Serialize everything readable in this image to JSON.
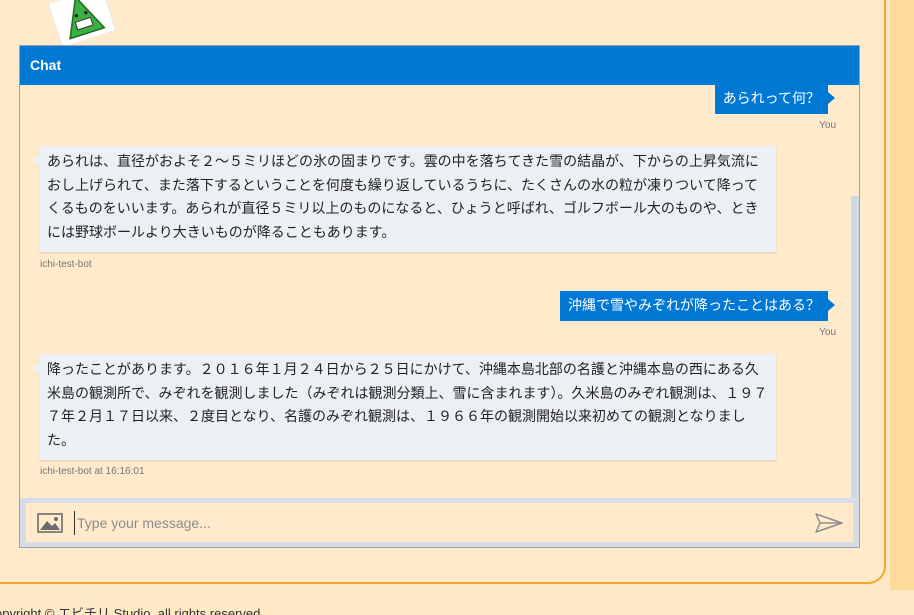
{
  "chat": {
    "title": "Chat",
    "messages": [
      {
        "from": "user",
        "text": "あられって何？",
        "meta": "You"
      },
      {
        "from": "bot",
        "text": "あられは、直径がおよそ２～５ミリほどの氷の固まりです。雲の中を落ちてきた雪の結晶が、下からの上昇気流におし上げられて、また落下するということを何度も繰り返しているうちに、たくさんの水の粒が凍りついて降ってくるものをいいます。あられが直径５ミリ以上のものになると、ひょうと呼ばれ、ゴルフボール大のものや、ときには野球ボールより大きいものが降ることもあります。",
        "meta": "ichi-test-bot"
      },
      {
        "from": "user",
        "text": "沖縄で雪やみぞれが降ったことはある？",
        "meta": "You"
      },
      {
        "from": "bot",
        "text": "降ったことがあります。２０１６年１月２４日から２５日にかけて、沖縄本島北部の名護と沖縄本島の西にある久米島の観測所で、みぞれを観測しました（みぞれは観測分類上、雪に含まれます）。久米島のみぞれ観測は、１９７７年２月１７日以来、２度目となり、名護のみぞれ観測は、１９６６年の観測開始以来初めての観測となりました。",
        "meta": "ichi-test-bot at 16:16:01"
      }
    ],
    "input": {
      "placeholder": "Type your message...",
      "value": ""
    },
    "icons": {
      "upload": "image-upload-icon",
      "send": "send-icon"
    },
    "accent_color": "#0078d4"
  },
  "footer": {
    "copyright": "opyright © エビチリ Studio. all rights reserved."
  }
}
